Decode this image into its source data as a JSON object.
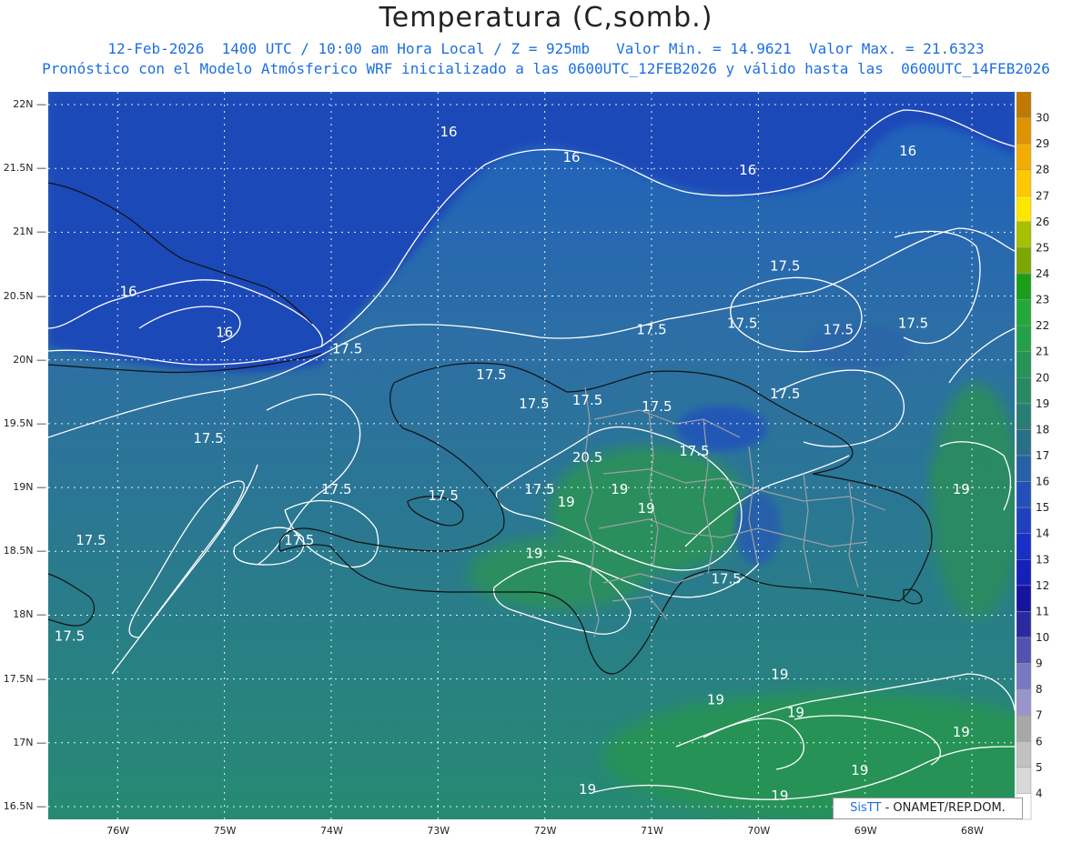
{
  "header": {
    "title": "Temperatura (C,somb.)",
    "line1": "12-Feb-2026  1400 UTC / 10:00 am Hora Local / Z = 925mb   Valor Min. = 14.9621  Valor Max. = 21.6323",
    "line2": "Pronóstico con el Modelo Atmósferico WRF inicializado a las 0600UTC_12FEB2026 y válido hasta las  0600UTC_14FEB2026"
  },
  "map": {
    "lat_ticks": [
      "22N",
      "21.5N",
      "21N",
      "20.5N",
      "20N",
      "19.5N",
      "19N",
      "18.5N",
      "18N",
      "17.5N",
      "17N",
      "16.5N"
    ],
    "lon_ticks": [
      "76W",
      "75W",
      "74W",
      "73W",
      "72W",
      "71W",
      "70W",
      "69W",
      "68W"
    ],
    "contour_labels": [
      {
        "text": "16",
        "lon": -72.9,
        "lat": 21.75
      },
      {
        "text": "16",
        "lon": -71.75,
        "lat": 21.55
      },
      {
        "text": "16",
        "lon": -70.1,
        "lat": 21.45
      },
      {
        "text": "16",
        "lon": -68.6,
        "lat": 21.6
      },
      {
        "text": "16",
        "lon": -75.9,
        "lat": 20.5
      },
      {
        "text": "16",
        "lon": -75.0,
        "lat": 20.18
      },
      {
        "text": "17.5",
        "lon": -73.85,
        "lat": 20.05
      },
      {
        "text": "17.5",
        "lon": -72.5,
        "lat": 19.85
      },
      {
        "text": "17.5",
        "lon": -72.1,
        "lat": 19.62
      },
      {
        "text": "17.5",
        "lon": -71.6,
        "lat": 19.65
      },
      {
        "text": "17.5",
        "lon": -70.95,
        "lat": 19.6
      },
      {
        "text": "17.5",
        "lon": -70.15,
        "lat": 20.25
      },
      {
        "text": "17.5",
        "lon": -71.0,
        "lat": 20.2
      },
      {
        "text": "17.5",
        "lon": -69.75,
        "lat": 20.7
      },
      {
        "text": "17.5",
        "lon": -69.25,
        "lat": 20.2
      },
      {
        "text": "17.5",
        "lon": -68.55,
        "lat": 20.25
      },
      {
        "text": "17.5",
        "lon": -69.75,
        "lat": 19.7
      },
      {
        "text": "17.5",
        "lon": -70.6,
        "lat": 19.25
      },
      {
        "text": "17.5",
        "lon": -75.15,
        "lat": 19.35
      },
      {
        "text": "17.5",
        "lon": -73.95,
        "lat": 18.95
      },
      {
        "text": "17.5",
        "lon": -72.95,
        "lat": 18.9
      },
      {
        "text": "17.5",
        "lon": -74.3,
        "lat": 18.55
      },
      {
        "text": "17.5",
        "lon": -76.25,
        "lat": 18.55
      },
      {
        "text": "17.5",
        "lon": -76.45,
        "lat": 17.8
      },
      {
        "text": "17.5",
        "lon": -72.05,
        "lat": 18.95
      },
      {
        "text": "17.5",
        "lon": -70.3,
        "lat": 18.25
      },
      {
        "text": "20.5",
        "lon": -71.6,
        "lat": 19.2
      },
      {
        "text": "19",
        "lon": -71.3,
        "lat": 18.95
      },
      {
        "text": "19",
        "lon": -71.8,
        "lat": 18.85
      },
      {
        "text": "19",
        "lon": -71.05,
        "lat": 18.8
      },
      {
        "text": "19",
        "lon": -72.1,
        "lat": 18.45
      },
      {
        "text": "19",
        "lon": -69.8,
        "lat": 17.5
      },
      {
        "text": "19",
        "lon": -70.4,
        "lat": 17.3
      },
      {
        "text": "19",
        "lon": -69.65,
        "lat": 17.2
      },
      {
        "text": "19",
        "lon": -68.1,
        "lat": 18.95
      },
      {
        "text": "19",
        "lon": -68.1,
        "lat": 17.05
      },
      {
        "text": "19",
        "lon": -69.05,
        "lat": 16.75
      },
      {
        "text": "19",
        "lon": -69.8,
        "lat": 16.55
      },
      {
        "text": "19",
        "lon": -71.6,
        "lat": 16.6
      }
    ]
  },
  "colorbar": {
    "levels": [
      "30",
      "29",
      "28",
      "27",
      "26",
      "25",
      "24",
      "23",
      "22",
      "21",
      "20",
      "19",
      "18",
      "17",
      "16",
      "15",
      "14",
      "13",
      "12",
      "11",
      "10",
      "9",
      "8",
      "7",
      "6",
      "5",
      "4"
    ],
    "colors": [
      "#c07800",
      "#dd9400",
      "#f2ae00",
      "#ffc800",
      "#ffe600",
      "#a5c000",
      "#7aa800",
      "#1a9e1a",
      "#22a83a",
      "#24a048",
      "#279455",
      "#288a64",
      "#2a7d74",
      "#2a6f88",
      "#2860a8",
      "#2350b8",
      "#1f40c0",
      "#1a2fc6",
      "#1420b8",
      "#1414a0",
      "#2a2aa0",
      "#5252b0",
      "#7878c0",
      "#9a94cc",
      "#a8a8a8",
      "#c2c2c2",
      "#d8d8d8",
      "#ffffff"
    ]
  },
  "credit": {
    "brand": "SisTT",
    "text": "- ONAMET/REP.DOM."
  }
}
